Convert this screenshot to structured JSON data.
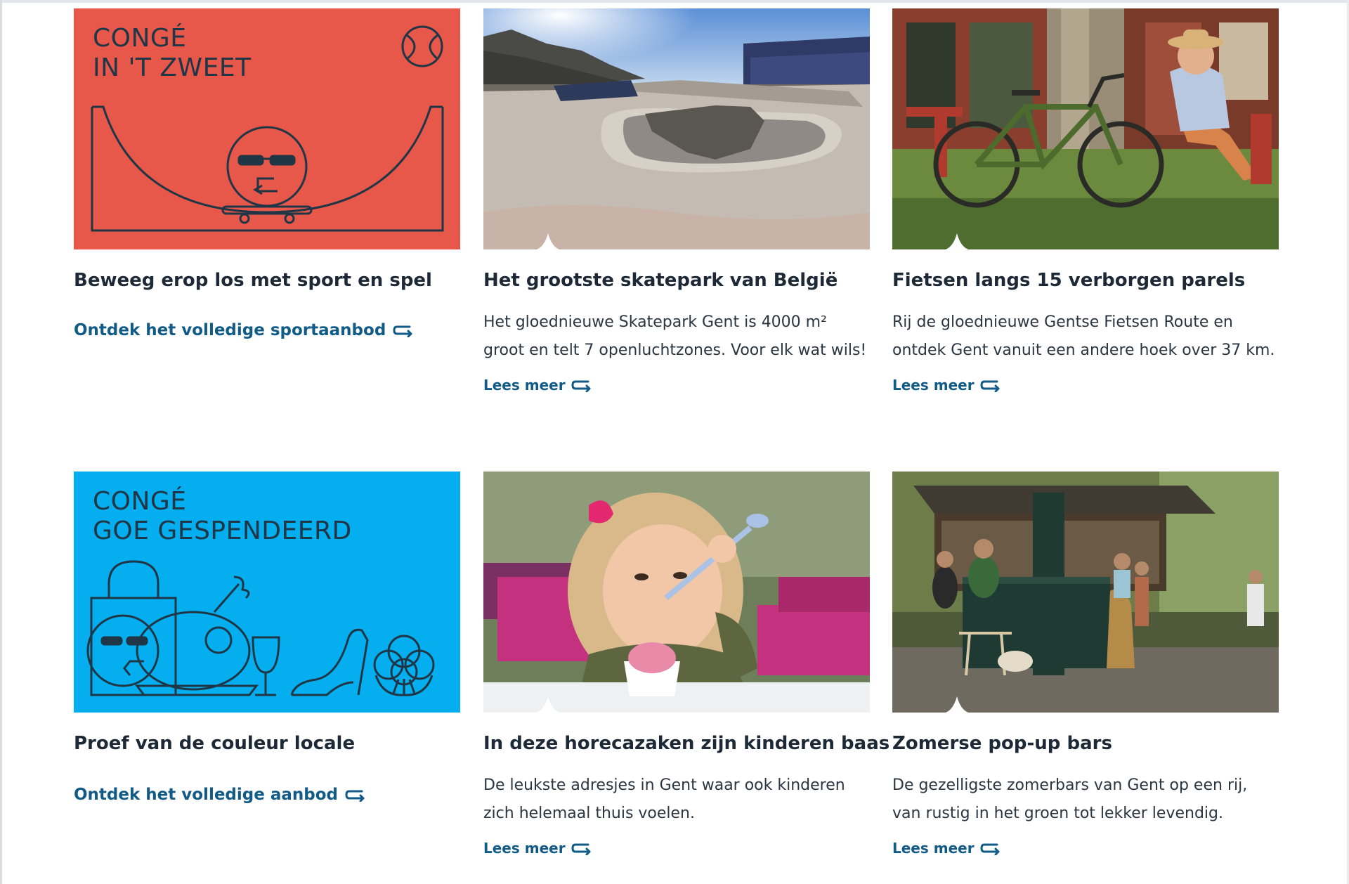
{
  "colors": {
    "sport_card": "#e8584a",
    "food_card": "#05aeee",
    "link": "#125b86",
    "title": "#1d2936",
    "line_art": "#1f3646"
  },
  "cards": [
    {
      "illustration_title_line1": "CONGÉ",
      "illustration_title_line2": "IN 'T ZWEET",
      "title": "Beweeg erop los met sport en spel",
      "link": "Ontdek het volledige sportaanbod",
      "icons": [
        "tennis-ball-icon",
        "halfpipe-skater-icon"
      ]
    },
    {
      "image": "skatepark-photo",
      "title": "Het grootste skatepark van België",
      "description": "Het gloednieuwe Skatepark Gent is 4000 m² groot en telt 7 openluchtzones. Voor elk wat wils!",
      "link": "Lees meer"
    },
    {
      "image": "bicycle-photo",
      "title": "Fietsen langs 15 verborgen parels",
      "description": "Rij de gloednieuwe Gentse Fietsen Route en ontdek Gent vanuit een andere hoek over 37 km.",
      "link": "Lees meer"
    },
    {
      "illustration_title_line1": "CONGÉ",
      "illustration_title_line2": "GOE GESPENDEERD",
      "title": "Proef van de couleur locale",
      "link": "Ontdek het volledige aanbod",
      "icons": [
        "shopping-bag-icon",
        "roast-chicken-icon",
        "wine-glass-icon",
        "high-heel-icon",
        "cauliflower-icon"
      ]
    },
    {
      "image": "child-ice-cream-photo",
      "title": "In deze horecazaken zijn kinderen baas",
      "description": "De leukste adresjes in Gent waar ook kinderen zich helemaal thuis voelen.",
      "link": "Lees meer"
    },
    {
      "image": "popup-bar-photo",
      "title": "Zomerse pop-up bars",
      "description": "De gezelligste zomerbars van Gent op een rij, van rustig in het groen tot lekker levendig.",
      "link": "Lees meer"
    }
  ]
}
